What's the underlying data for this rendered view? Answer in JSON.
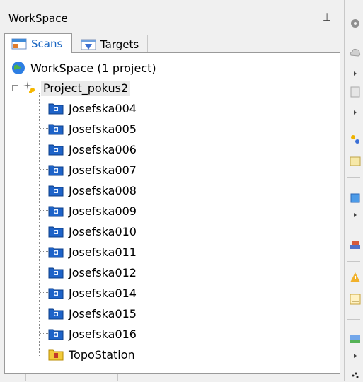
{
  "panel": {
    "title": "WorkSpace",
    "pin_icon": "pin-icon"
  },
  "tabs": [
    {
      "label": "Scans",
      "icon": "scans-tab-icon",
      "active": true
    },
    {
      "label": "Targets",
      "icon": "targets-tab-icon",
      "active": false
    }
  ],
  "tree": {
    "root_label": "WorkSpace  (1 project)",
    "project_label": "Project_pokus2",
    "scans": [
      "Josefska004",
      "Josefska005",
      "Josefska006",
      "Josefska007",
      "Josefska008",
      "Josefska009",
      "Josefska010",
      "Josefska011",
      "Josefska012",
      "Josefska014",
      "Josefska015",
      "Josefska016"
    ],
    "topo_label": "TopoStation"
  },
  "colors": {
    "accent": "#1a66c2",
    "scan_icon": "#1e63c8",
    "topo_icon": "#f2cb3b"
  }
}
